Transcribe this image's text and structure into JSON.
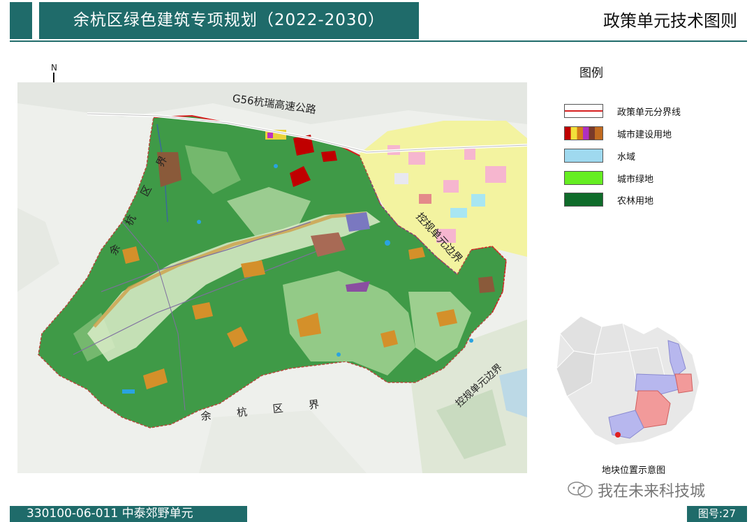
{
  "header": {
    "title": "余杭区绿色建筑专项规划（2022-2030）",
    "right_title": "政策单元技术图则"
  },
  "map": {
    "north": "N",
    "labels": {
      "highway": "G56杭瑞高速公路",
      "district_left": "余 杭 区 界",
      "district_bottom": "余 杭 区 界",
      "control_1": "控规单元边界",
      "control_2": "控规单元边界"
    }
  },
  "legend": {
    "title": "图例",
    "items": [
      {
        "label": "政策单元分界线",
        "color": "#d62020"
      },
      {
        "label": "城市建设用地",
        "color": "#c00000"
      },
      {
        "label": "水域",
        "color": "#9fd9ef"
      },
      {
        "label": "城市绿地",
        "color": "#66ee22"
      },
      {
        "label": "农林用地",
        "color": "#0f6b2a"
      }
    ]
  },
  "locator": {
    "caption": "地块位置示意图"
  },
  "watermark": "我在未来科技城",
  "footer": {
    "unit": "330100-06-011 中泰郊野单元",
    "page": "图号:27"
  }
}
